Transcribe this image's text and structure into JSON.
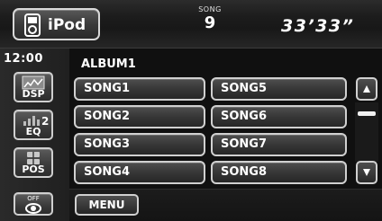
{
  "header": {
    "source_label": "iPod",
    "song_caption": "SONG",
    "song_number": "9",
    "elapsed_time": "33’33”"
  },
  "sidebar": {
    "clock": "12:00",
    "buttons": [
      {
        "label": "DSP",
        "icon": "dsp-icon"
      },
      {
        "label": "EQ",
        "icon": "eq-icon"
      },
      {
        "label": "POS",
        "icon": "pos-icon"
      },
      {
        "label": "OFF",
        "icon": "power-off-icon"
      }
    ]
  },
  "main": {
    "album_title": "ALBUM1",
    "songs": [
      "SONG1",
      "SONG2",
      "SONG3",
      "SONG4",
      "SONG5",
      "SONG6",
      "SONG7",
      "SONG8"
    ],
    "menu_label": "MENU"
  },
  "colors": {
    "background": "#111111",
    "button_border": "#d0d0d0",
    "text": "#ffffff"
  }
}
